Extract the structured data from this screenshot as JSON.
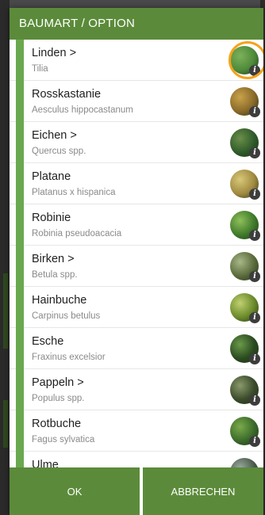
{
  "dialog": {
    "title": "BAUMART / OPTION",
    "ok_label": "OK",
    "cancel_label": "ABBRECHEN"
  },
  "items": [
    {
      "name": "Linden >",
      "latin": "Tilia",
      "thumb_colors": [
        "#4e8a3a",
        "#7db15a"
      ],
      "highlighted": true
    },
    {
      "name": "Rosskastanie",
      "latin": "Aesculus hippocastanum",
      "thumb_colors": [
        "#8a6a2a",
        "#c9a24a"
      ]
    },
    {
      "name": "Eichen >",
      "latin": "Quercus spp.",
      "thumb_colors": [
        "#2f5a2a",
        "#6b8f4a"
      ]
    },
    {
      "name": "Platane",
      "latin": "Platanus x hispanica",
      "thumb_colors": [
        "#a08a40",
        "#d8c878"
      ]
    },
    {
      "name": "Robinie",
      "latin": "Robinia pseudoacacia",
      "thumb_colors": [
        "#3f7a2a",
        "#8fbf5a"
      ]
    },
    {
      "name": "Birken >",
      "latin": "Betula spp.",
      "thumb_colors": [
        "#5a6a3a",
        "#a8b888"
      ]
    },
    {
      "name": "Hainbuche",
      "latin": "Carpinus betulus",
      "thumb_colors": [
        "#6a8a2a",
        "#c0d070"
      ]
    },
    {
      "name": "Esche",
      "latin": "Fraxinus excelsior",
      "thumb_colors": [
        "#2a4a1f",
        "#6a9a4a"
      ]
    },
    {
      "name": "Pappeln >",
      "latin": "Populus spp.",
      "thumb_colors": [
        "#3a4a2a",
        "#8a9a6a"
      ]
    },
    {
      "name": "Rotbuche",
      "latin": "Fagus sylvatica",
      "thumb_colors": [
        "#3a6a2a",
        "#7aaa4a"
      ]
    },
    {
      "name": "Ulme",
      "latin": "",
      "thumb_colors": [
        "#4a5a4a",
        "#9aaaa0"
      ]
    }
  ],
  "colors": {
    "accent": "#5b8b3a",
    "item_bar": "#6aa84f",
    "highlight_ring": "#f5a31a"
  },
  "icons": {
    "info": "info-icon"
  }
}
